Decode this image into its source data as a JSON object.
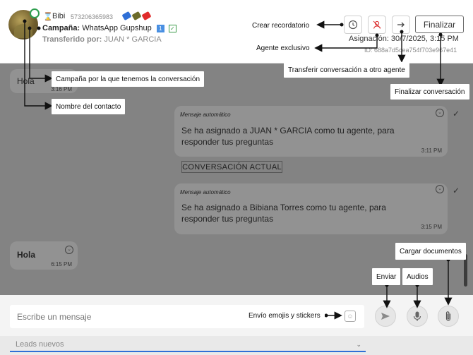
{
  "header": {
    "contact_name": "Bibi",
    "contact_phone": "573206365983",
    "tag_colors": [
      "#2f6fd6",
      "#6b6b2a",
      "#e02b2b"
    ],
    "campaign_label": "Campaña:",
    "campaign_name": "WhatsApp Gupshup",
    "campaign_badge": "1",
    "transfer_label": "Transferido por:",
    "transfer_agent": "JUAN * GARCIA",
    "finalize_label": "Finalizar",
    "assignment_text": "Asignación: 30/7/2025, 3:15 PM",
    "assignment_id": "ID: 688a7d5cea754f703e967e41",
    "icons": {
      "reminder": "clock-icon",
      "exclusive": "agent-exclusive-icon",
      "transfer": "arrow-right-icon"
    }
  },
  "chat": {
    "messages": [
      {
        "kind": "incoming",
        "text": "Hola",
        "time": "3:16 PM"
      },
      {
        "kind": "outgoing",
        "auto_label": "Mensaje automático",
        "text_line1": "Se ha asignado a JUAN * GARCIA como tu agente, para",
        "text_line2": "responder tus preguntas",
        "time": "3:11 PM"
      },
      {
        "kind": "outgoing",
        "auto_label": "Mensaje automático",
        "text_line1": "Se ha asignado a Bibiana  Torres como tu agente, para",
        "text_line2": "responder tus preguntas",
        "time": "3:15 PM"
      },
      {
        "kind": "incoming",
        "text": "Hola",
        "time": "6:15 PM"
      }
    ],
    "divider_label": "CONVERSACIÓN ACTUAL"
  },
  "composer": {
    "placeholder": "Escribe un mensaje",
    "icons": {
      "emoji": "emoji-icon",
      "send": "send-icon",
      "audio": "microphone-icon",
      "attach": "paperclip-icon"
    }
  },
  "footer": {
    "status_value": "Leads nuevos"
  },
  "annotations": {
    "reminder": "Crear recordatorio",
    "exclusive": "Agente exclusivo",
    "transfer": "Transferir conversación a otro agente",
    "finalize": "Finalizar conversación",
    "campaign": "Campaña por la que tenemos la conversación",
    "contact": "Nombre del contacto",
    "send": "Enviar",
    "audio": "Audios",
    "attach": "Cargar documentos",
    "emoji": "Envío emojis y stickers"
  }
}
